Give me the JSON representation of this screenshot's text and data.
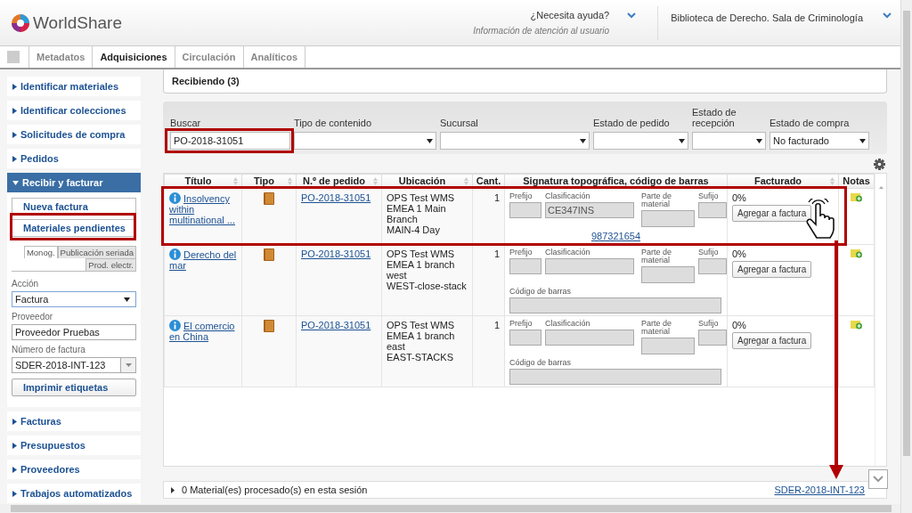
{
  "header": {
    "logo": "WorldShare",
    "help": {
      "title": "¿Necesita ayuda?",
      "subtitle": "Información de atención al usuario"
    },
    "library": "Biblioteca de Derecho. Sala de Criminología"
  },
  "tabs": [
    {
      "label": "Metadatos",
      "selected": false
    },
    {
      "label": "Adquisiciones",
      "selected": true
    },
    {
      "label": "Circulación",
      "selected": false
    },
    {
      "label": "Analíticos",
      "selected": false
    }
  ],
  "sidebar": {
    "items": [
      {
        "label": "Identificar materiales",
        "expanded": false
      },
      {
        "label": "Identificar colecciones",
        "expanded": false
      },
      {
        "label": "Solicitudes de compra",
        "expanded": false
      },
      {
        "label": "Pedidos",
        "expanded": false
      },
      {
        "label": "Recibir y facturar",
        "expanded": true,
        "links": [
          "Nueva factura",
          "Materiales pendientes"
        ],
        "subtabs": [
          {
            "label": "Monog.",
            "selected": true
          },
          {
            "label": "Publicación seriada",
            "selected": false
          },
          {
            "label": "Prod. electr.",
            "selected": false
          }
        ],
        "fields": [
          {
            "kind": "select",
            "label": "Acción",
            "value": "Factura"
          },
          {
            "kind": "text",
            "label": "Proveedor",
            "value": "Proveedor Pruebas"
          },
          {
            "kind": "combo",
            "label": "Número de factura",
            "value": "SDER-2018-INT-123"
          }
        ],
        "button": "Imprimir etiquetas"
      },
      {
        "label": "Facturas",
        "expanded": false
      },
      {
        "label": "Presupuestos",
        "expanded": false
      },
      {
        "label": "Proveedores",
        "expanded": false
      },
      {
        "label": "Trabajos automatizados",
        "expanded": false
      }
    ]
  },
  "main": {
    "panel_title": "Recibiendo (3)",
    "filters": [
      {
        "kind": "text",
        "label": "Buscar",
        "value": "PO-2018-31051"
      },
      {
        "kind": "select",
        "label": "Tipo de contenido"
      },
      {
        "kind": "select",
        "label": "Sucursal"
      },
      {
        "kind": "select",
        "label": "Estado de pedido"
      },
      {
        "kind": "select",
        "label": "Estado de recepción"
      },
      {
        "kind": "select",
        "label": "Estado de compra",
        "value": "No facturado"
      }
    ],
    "table": {
      "columns": [
        {
          "label": "Título",
          "sortable": true
        },
        {
          "label": "Tipo",
          "sortable": true
        },
        {
          "label": "N.º de pedido",
          "sortable": true
        },
        {
          "label": "Ubicación",
          "sortable": true
        },
        {
          "label": "Cant.",
          "sortable": false
        },
        {
          "label": "Signatura topográfica, código de barras",
          "sortable": false
        },
        {
          "label": "Facturado",
          "sortable": true
        },
        {
          "label": "Notas",
          "sortable": false
        }
      ],
      "rows": [
        {
          "title": "Insolvency within multinational ...",
          "order": "PO-2018-31051",
          "location": "OPS Test WMS EMEA 1 Main Branch",
          "shelf": "MAIN-4 Day",
          "qty": "1",
          "call_labels": {
            "prefix": "Prefijo",
            "classification": "Clasificación",
            "part": "Parte de material",
            "suffix": "Sufijo"
          },
          "classification": "CE347INS",
          "barcode_link": "987321654",
          "invoiced": "0%",
          "button": "Agregar a factura"
        },
        {
          "title": "Derecho del mar",
          "order": "PO-2018-31051",
          "location": "OPS Test WMS EMEA 1 branch west",
          "shelf": "WEST-close-stack",
          "qty": "1",
          "call_labels": {
            "prefix": "Prefijo",
            "classification": "Clasificación",
            "part": "Parte de material",
            "suffix": "Sufijo"
          },
          "barcode_label": "Código de barras",
          "invoiced": "0%",
          "button": "Agregar a factura"
        },
        {
          "title": "El comercio en China",
          "order": "PO-2018-31051",
          "location": "OPS Test WMS EMEA 1 branch east",
          "shelf": "EAST-STACKS",
          "qty": "1",
          "call_labels": {
            "prefix": "Prefijo",
            "classification": "Clasificación",
            "part": "Parte de material",
            "suffix": "Sufijo"
          },
          "barcode_label": "Código de barras",
          "invoiced": "0%",
          "button": "Agregar a factura"
        }
      ]
    },
    "footer": {
      "summary": "0 Material(es) procesado(s) en esta sesión",
      "invoice_link": "SDER-2018-INT-123"
    }
  }
}
